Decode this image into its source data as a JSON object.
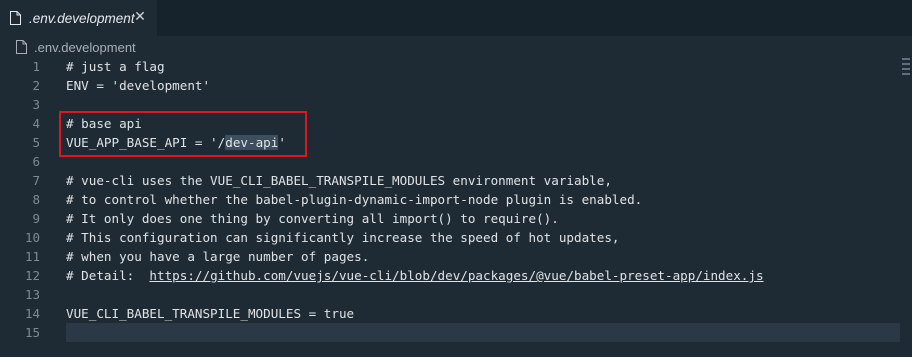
{
  "tab": {
    "label": ".env.development",
    "close_glyph": "✕",
    "icon": "file-icon"
  },
  "breadcrumb": {
    "label": ".env.development",
    "icon": "file-icon"
  },
  "lines": [
    {
      "num": "1",
      "text": "# just a flag"
    },
    {
      "num": "2",
      "text": "ENV = 'development'"
    },
    {
      "num": "3",
      "text": ""
    },
    {
      "num": "4",
      "text": "# base api"
    },
    {
      "num": "5",
      "pre": "VUE_APP_BASE_API = '/",
      "highlight": "dev-api",
      "post": "'"
    },
    {
      "num": "6",
      "text": ""
    },
    {
      "num": "7",
      "text": "# vue-cli uses the VUE_CLI_BABEL_TRANSPILE_MODULES environment variable,"
    },
    {
      "num": "8",
      "text": "# to control whether the babel-plugin-dynamic-import-node plugin is enabled."
    },
    {
      "num": "9",
      "text": "# It only does one thing by converting all import() to require()."
    },
    {
      "num": "10",
      "text": "# This configuration can significantly increase the speed of hot updates,"
    },
    {
      "num": "11",
      "text": "# when you have a large number of pages."
    },
    {
      "num": "12",
      "pre": "# Detail:  ",
      "link": "https://github.com/vuejs/vue-cli/blob/dev/packages/@vue/babel-preset-app/index.js"
    },
    {
      "num": "13",
      "text": ""
    },
    {
      "num": "14",
      "text": "VUE_CLI_BABEL_TRANSPILE_MODULES = true"
    },
    {
      "num": "15",
      "text": ""
    }
  ],
  "colors": {
    "background": "#1e2b35",
    "annotation_box": "#e0161d",
    "text": "#dfe3e6"
  }
}
